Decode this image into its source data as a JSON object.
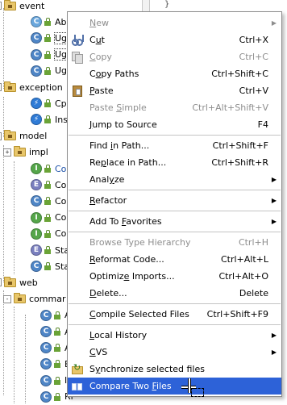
{
  "tree": {
    "rows": [
      {
        "type": "pkg",
        "indent": 0,
        "label": "event",
        "expander": "-"
      },
      {
        "type": "cls",
        "indent": 2,
        "kind": "A",
        "label": "Abstra",
        "lock": true
      },
      {
        "type": "cls",
        "indent": 2,
        "kind": "C",
        "label": "UgcBa",
        "lock": true,
        "selected": true
      },
      {
        "type": "cls",
        "indent": 2,
        "kind": "C",
        "label": "UgcC",
        "lock": true,
        "selected": true
      },
      {
        "type": "cls",
        "indent": 2,
        "kind": "C",
        "label": "UgcU",
        "lock": true
      },
      {
        "type": "pkg",
        "indent": 0,
        "label": "exception",
        "expander": "-"
      },
      {
        "type": "cls",
        "indent": 2,
        "kind": "X",
        "label": "CpsPu",
        "lock": true
      },
      {
        "type": "cls",
        "indent": 2,
        "kind": "X",
        "label": "Insuff",
        "lock": true
      },
      {
        "type": "pkg",
        "indent": 0,
        "label": "model",
        "expander": "-"
      },
      {
        "type": "pkg",
        "indent": 1,
        "label": "impl",
        "expander": "+"
      },
      {
        "type": "cls",
        "indent": 2,
        "kind": "I",
        "label": "Conte",
        "lock": true,
        "blue": true
      },
      {
        "type": "cls",
        "indent": 2,
        "kind": "E",
        "label": "Conte",
        "lock": true
      },
      {
        "type": "cls",
        "indent": 2,
        "kind": "C",
        "label": "Conte",
        "lock": true
      },
      {
        "type": "cls",
        "indent": 2,
        "kind": "I",
        "label": "Conte",
        "lock": true
      },
      {
        "type": "cls",
        "indent": 2,
        "kind": "I",
        "label": "Conte",
        "lock": true
      },
      {
        "type": "cls",
        "indent": 2,
        "kind": "E",
        "label": "Status",
        "lock": true
      },
      {
        "type": "cls",
        "indent": 2,
        "kind": "C",
        "label": "Status",
        "lock": true
      },
      {
        "type": "pkg",
        "indent": 0,
        "label": "web",
        "expander": "-"
      },
      {
        "type": "pkg",
        "indent": 1,
        "label": "commar",
        "expander": "-"
      },
      {
        "type": "cls",
        "indent": 3,
        "kind": "C",
        "label": "Ac",
        "lock": true
      },
      {
        "type": "cls",
        "indent": 3,
        "kind": "C",
        "label": "Ac",
        "lock": true
      },
      {
        "type": "cls",
        "indent": 3,
        "kind": "C",
        "label": "Ac",
        "lock": true
      },
      {
        "type": "cls",
        "indent": 3,
        "kind": "C",
        "label": "Ba",
        "lock": true
      },
      {
        "type": "cls",
        "indent": 3,
        "kind": "C",
        "label": "In",
        "lock": true
      },
      {
        "type": "cls",
        "indent": 3,
        "kind": "C",
        "label": "Ri",
        "lock": true
      }
    ]
  },
  "editor": {
    "brace": "}"
  },
  "menu": {
    "items": [
      {
        "kind": "item",
        "label": "New",
        "u": 0,
        "disabled": true,
        "submenu": true
      },
      {
        "kind": "item",
        "label": "Cut",
        "u": 1,
        "key": "Ctrl+X",
        "icon": "scissors"
      },
      {
        "kind": "item",
        "label": "Copy",
        "u": 0,
        "key": "Ctrl+C",
        "icon": "copy",
        "disabled": true
      },
      {
        "kind": "item",
        "label": "Copy Paths",
        "u": 1,
        "key": "Ctrl+Shift+C"
      },
      {
        "kind": "item",
        "label": "Paste",
        "u": 0,
        "key": "Ctrl+V",
        "icon": "paste"
      },
      {
        "kind": "item",
        "label": "Paste Simple",
        "u": 6,
        "key": "Ctrl+Alt+Shift+V",
        "disabled": true
      },
      {
        "kind": "item",
        "label": "Jump to Source",
        "u": 0,
        "key": "F4"
      },
      {
        "kind": "sep"
      },
      {
        "kind": "item",
        "label": "Find in Path...",
        "u": 5,
        "key": "Ctrl+Shift+F"
      },
      {
        "kind": "item",
        "label": "Replace in Path...",
        "u": 2,
        "key": "Ctrl+Shift+R"
      },
      {
        "kind": "item",
        "label": "Analyze",
        "u": 4,
        "submenu": true
      },
      {
        "kind": "sep"
      },
      {
        "kind": "item",
        "label": "Refactor",
        "u": 0,
        "submenu": true
      },
      {
        "kind": "sep"
      },
      {
        "kind": "item",
        "label": "Add To Favorites",
        "u": 7,
        "submenu": true
      },
      {
        "kind": "sep"
      },
      {
        "kind": "item",
        "label": "Browse Type Hierarchy",
        "u": -1,
        "key": "Ctrl+H",
        "disabled": true
      },
      {
        "kind": "item",
        "label": "Reformat Code...",
        "u": 0,
        "key": "Ctrl+Alt+L"
      },
      {
        "kind": "item",
        "label": "Optimize Imports...",
        "u": 7,
        "key": "Ctrl+Alt+O"
      },
      {
        "kind": "item",
        "label": "Delete...",
        "u": 0,
        "key": "Delete"
      },
      {
        "kind": "sep"
      },
      {
        "kind": "item",
        "label": "Compile Selected Files",
        "u": 0,
        "key": "Ctrl+Shift+F9"
      },
      {
        "kind": "sep"
      },
      {
        "kind": "item",
        "label": "Local History",
        "u": 0,
        "submenu": true
      },
      {
        "kind": "item",
        "label": "CVS",
        "u": 0,
        "submenu": true
      },
      {
        "kind": "item",
        "label": "Synchronize selected files",
        "u": 1,
        "icon": "sync"
      },
      {
        "kind": "item",
        "label": "Compare Two Files",
        "u": 12,
        "icon": "compare",
        "highlighted": true
      }
    ]
  },
  "colors": {
    "highlight": "#2d62d8",
    "disabled": "#8e8e8e"
  }
}
